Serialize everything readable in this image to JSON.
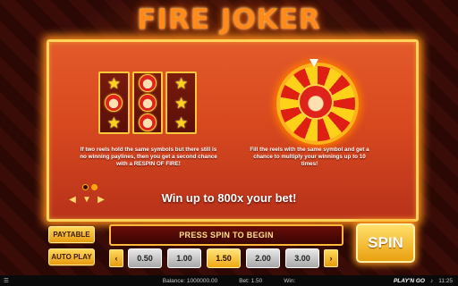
{
  "title": "FIRE JOKER",
  "info": {
    "desc_left": "If two reels hold the same symbols but there still is no winning paylines, then you get a second chance with a RESPIN OF FIRE!",
    "desc_right": "Fill the reels with the same symbol and get a chance to multiply your winnings up to 10 times!",
    "headline": "Win up to 800x your bet!",
    "page_indicator": {
      "pages": 2,
      "active": 2
    }
  },
  "reels": [
    [
      "star-icon",
      "joker-icon",
      "star-icon"
    ],
    [
      "joker-icon",
      "joker-icon",
      "joker-icon"
    ],
    [
      "star-icon",
      "star-icon",
      "star-icon"
    ]
  ],
  "controls": {
    "paytable_label": "PAYTABLE",
    "autoplay_label": "AUTO PLAY",
    "message": "PRESS SPIN TO BEGIN",
    "bet_prev": "‹",
    "bet_next": "›",
    "bets": [
      "0.50",
      "1.00",
      "1.50",
      "2.00",
      "3.00"
    ],
    "selected_bet": "1.50",
    "spin_label": "SPIN"
  },
  "status_bar": {
    "balance": "Balance: 1000000.00",
    "bet": "Bet: 1.50",
    "win": "Win:",
    "logo": "PLAY'N GO",
    "time": "11:25"
  },
  "colors": {
    "panel": "#d8491f",
    "frame": "#ffd35a",
    "button_gold": "#f0a812",
    "reel_bg": "#7a1a0e"
  }
}
